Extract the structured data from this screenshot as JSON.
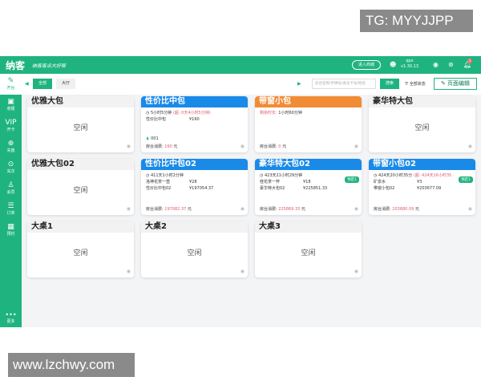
{
  "watermarks": {
    "top": "TG: MYYJJPP",
    "bottom": "www.lzchwy.com"
  },
  "header": {
    "logo": "纳客",
    "slogan": "纳客客点大好帮",
    "enter_store": "进入商城",
    "user": "qpx",
    "version": "v1.30.13",
    "notification_count": "1"
  },
  "sidebar": {
    "items": [
      {
        "label": "开台",
        "icon": "table-edit-icon"
      },
      {
        "label": "收银",
        "icon": "cashier-icon"
      },
      {
        "label": "开卡",
        "icon": "vip-card-icon"
      },
      {
        "label": "充值",
        "icon": "recharge-icon"
      },
      {
        "label": "充次",
        "icon": "count-icon"
      },
      {
        "label": "会员",
        "icon": "member-icon"
      },
      {
        "label": "订单",
        "icon": "order-icon"
      },
      {
        "label": "预约",
        "icon": "calendar-icon"
      }
    ],
    "more": "更多"
  },
  "toolbar": {
    "tabs": [
      "全部",
      "大厅"
    ],
    "search_placeholder": "房台名称/手牌号/会员卡号/姓名",
    "search_btn": "搜索",
    "status_filter": "全部状态",
    "edit_page": "页面编辑"
  },
  "colors": {
    "accent": "#1fb47f",
    "blue": "#1a8ae8",
    "orange": "#f28b35"
  },
  "rooms": [
    {
      "name": "优雅大包",
      "status": "空闲"
    },
    {
      "name": "性价比中包",
      "duration": "5小时5分钟",
      "extra": "(超: 0天4小时5分钟)",
      "items": [
        [
          "性价比中包",
          "¥160"
        ]
      ],
      "member": "001",
      "consume_label": "房台消费:",
      "consume": "160",
      "unit": "元"
    },
    {
      "name": "带窗小包",
      "remain_label": "剩余时长:",
      "remain": "1小时60分钟",
      "consume_label": "房台消费:",
      "consume": "0",
      "unit": "元"
    },
    {
      "name": "豪华特大包",
      "status": "空闲"
    },
    {
      "name": "优雅大包02",
      "status": "空闲"
    },
    {
      "name": "性价比中包02",
      "duration": "411天1小时2分钟",
      "items": [
        [
          "洛神花茶一壶",
          "¥28"
        ],
        [
          "性价比中包02",
          "¥197054.37"
        ]
      ],
      "consume_label": "房台消费:",
      "consume": "197082.37",
      "unit": "元"
    },
    {
      "name": "豪华特大包02",
      "duration": "423天21小时29分钟",
      "tag": "预定1",
      "items": [
        [
          "桂花茶一杯",
          "¥18"
        ],
        [
          "豪华特大包02",
          "¥225851.33"
        ]
      ],
      "consume_label": "房台消费:",
      "consume": "225869.33",
      "unit": "元"
    },
    {
      "name": "带窗小包02",
      "duration": "424天20小时35分",
      "extra": "(超: 424天16小时35",
      "tag": "预定1",
      "items": [
        [
          "矿泉水",
          "¥3"
        ],
        [
          "带窗小包02",
          "¥203677.09"
        ]
      ],
      "consume_label": "房台消费:",
      "consume": "203680.09",
      "unit": "元"
    },
    {
      "name": "大桌1",
      "status": "空闲"
    },
    {
      "name": "大桌2",
      "status": "空闲"
    },
    {
      "name": "大桌3",
      "status": "空闲"
    }
  ]
}
